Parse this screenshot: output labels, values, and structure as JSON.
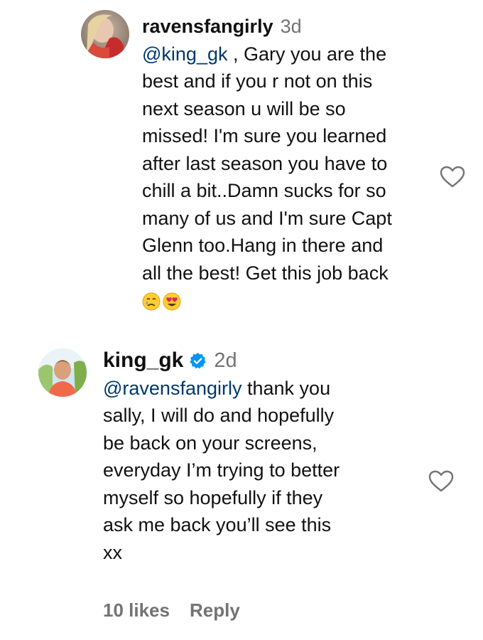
{
  "colors": {
    "text": "#111111",
    "mention": "#00376b",
    "muted": "#737373",
    "verified": "#0095f6"
  },
  "comments": [
    {
      "username": "ravensfangirly",
      "time": "3d",
      "mention": "@king_gk",
      "text": " , Gary you are the\nbest and if you r not on this\nnext season u will be so\nmissed! I'm sure you learned\nafter last season you have to\nchill a bit..Damn sucks for so\nmany of us and I'm sure Capt\nGlenn too.Hang in there and\nall the best! Get this job back",
      "emojis": [
        "crying-face",
        "heart-eyes-face"
      ],
      "icon": "heart-outline-icon"
    },
    {
      "username": "king_gk",
      "verified": true,
      "time": "2d",
      "mention": "@ravensfangirly",
      "text": " thank you\nsally, I will do and hopefully\nbe back on your screens,\neveryday I’m trying to better\nmyself so hopefully if they\nask me back you’ll see this\nxx",
      "icon": "heart-outline-icon"
    }
  ],
  "footer": {
    "likes": "10 likes",
    "reply": "Reply"
  }
}
